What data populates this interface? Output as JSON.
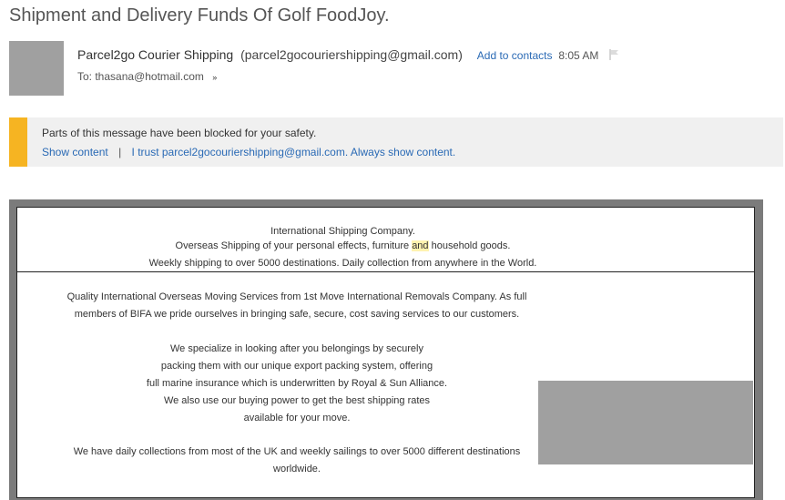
{
  "email": {
    "subject": "Shipment and Delivery Funds Of Golf FoodJoy.",
    "sender_name": "Parcel2go Courier Shipping",
    "sender_email": "(parcel2gocouriershipping@gmail.com)",
    "add_contacts": "Add to contacts",
    "time": "8:05 AM",
    "to_line": "To: thasana@hotmail.com",
    "expand_glyph": "»"
  },
  "banner": {
    "message": "Parts of this message have been blocked for your safety.",
    "show_content": "Show content",
    "separator": "|",
    "trust_link": "I trust parcel2gocouriershipping@gmail.com. Always show content.",
    "accent_color": "#f6b422"
  },
  "content": {
    "header": {
      "line1": "International Shipping Company.",
      "line2_before": "Overseas Shipping of your personal effects, furniture ",
      "line2_highlight": "and",
      "line2_after": " household goods.",
      "line3": "Weekly shipping to over 5000 destinations. Daily collection from anywhere in the World."
    },
    "paragraph1": [
      "Quality International Overseas Moving Services from 1st Move International Removals Company.  As full",
      "members of BIFA we pride ourselves in bringing safe, secure, cost saving services to our customers."
    ],
    "paragraph2": [
      "We specialize in looking after you belongings by securely",
      "packing them with our unique export packing system, offering",
      "full marine insurance which is underwritten by Royal & Sun Alliance.",
      "We also use our buying power to get the best shipping rates",
      "available for your move."
    ],
    "paragraph3": [
      "We have daily collections from most of the UK and weekly sailings to over 5000 different destinations",
      "worldwide."
    ]
  },
  "icons": {
    "flag": "flag-icon",
    "avatar": "avatar-placeholder"
  }
}
